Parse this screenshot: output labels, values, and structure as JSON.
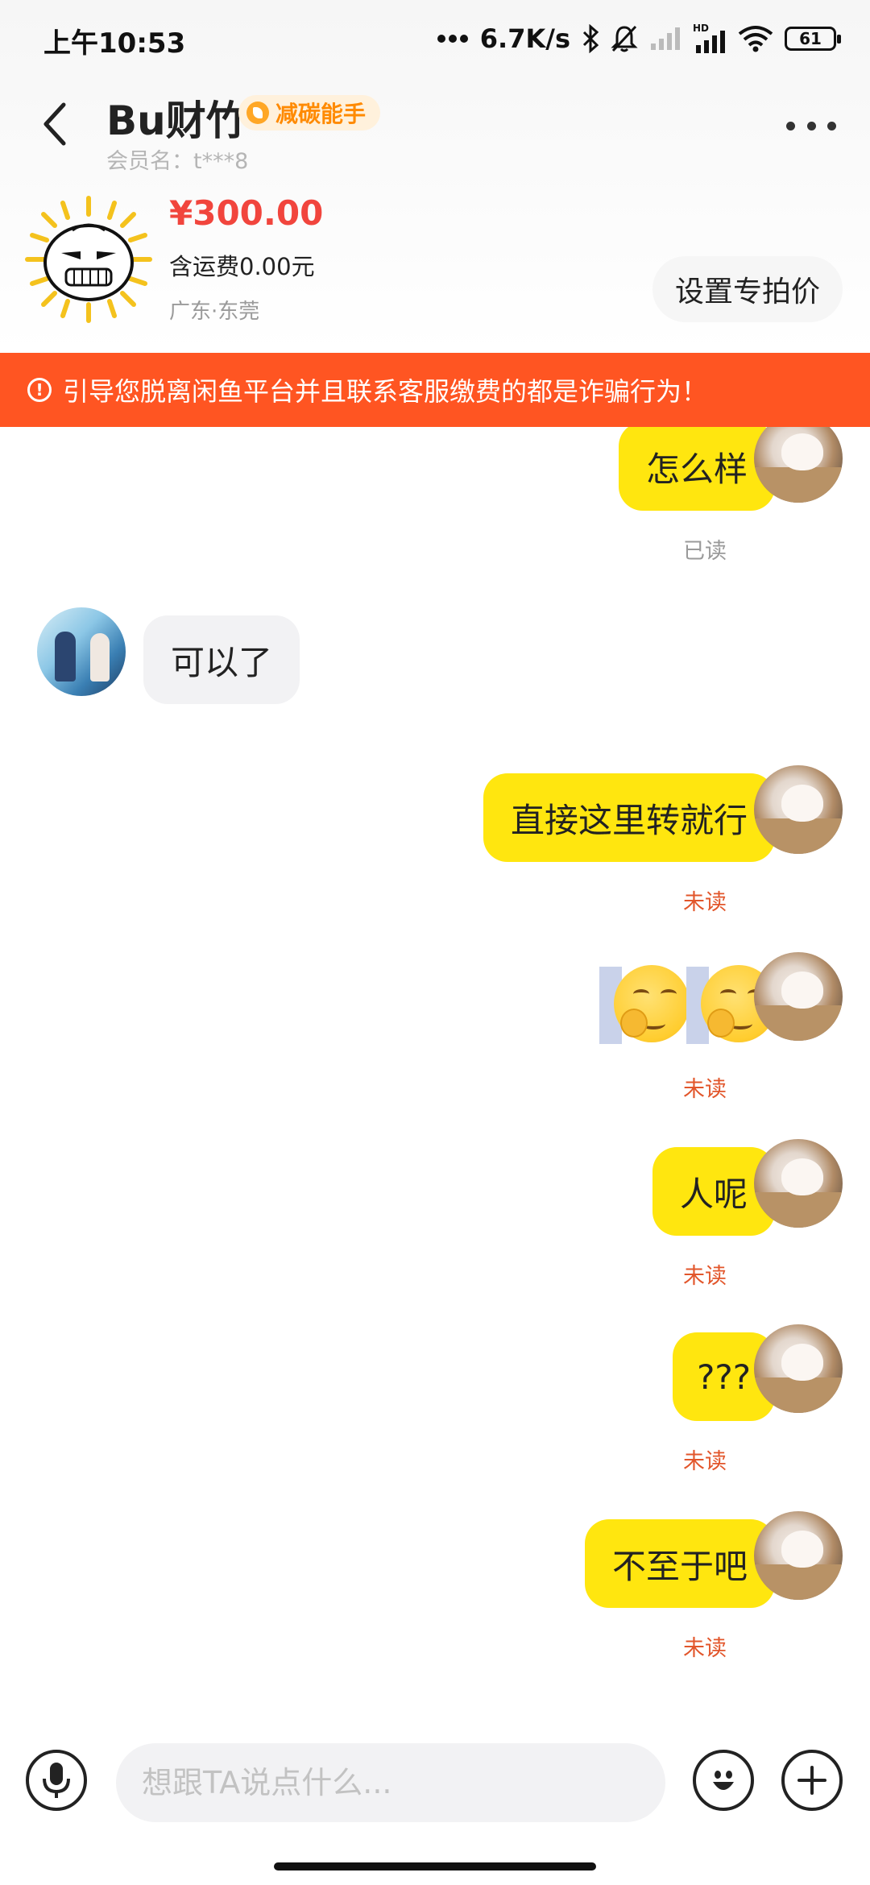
{
  "status_bar": {
    "time": "上午10:53",
    "network_speed": "6.7K/s",
    "battery": "61",
    "icons": [
      "bluetooth-icon",
      "mute-icon",
      "signal-icon",
      "hd-signal-icon",
      "wifi-icon",
      "battery-icon"
    ]
  },
  "header": {
    "seller_name": "Bu财竹",
    "badge": "减碳能手",
    "member_name": "会员名：t***8"
  },
  "product": {
    "price": "¥300.00",
    "shipping": "含运费0.00元",
    "location": "广东·东莞",
    "set_price_label": "设置专拍价"
  },
  "warning": {
    "text": "引导您脱离闲鱼平台并且联系客服缴费的都是诈骗行为！"
  },
  "messages": [
    {
      "sender": "me",
      "type": "text",
      "text": "怎么样",
      "status": "已读"
    },
    {
      "sender": "other",
      "type": "text",
      "text": "可以了"
    },
    {
      "sender": "me",
      "type": "text",
      "text": "直接这里转就行",
      "status": "未读"
    },
    {
      "sender": "me",
      "type": "emoji",
      "emoji": "smirk-emoji",
      "count": 2,
      "status": "未读"
    },
    {
      "sender": "me",
      "type": "text",
      "text": "人呢",
      "status": "未读"
    },
    {
      "sender": "me",
      "type": "text",
      "text": "???",
      "status": "未读"
    },
    {
      "sender": "me",
      "type": "text",
      "text": "不至于吧",
      "status": "未读"
    }
  ],
  "input": {
    "placeholder": "想跟TA说点什么..."
  },
  "colors": {
    "accent_yellow": "#ffe60f",
    "warning_orange": "#ff5522",
    "price_red": "#f1453d",
    "unread_red": "#e2562b"
  }
}
